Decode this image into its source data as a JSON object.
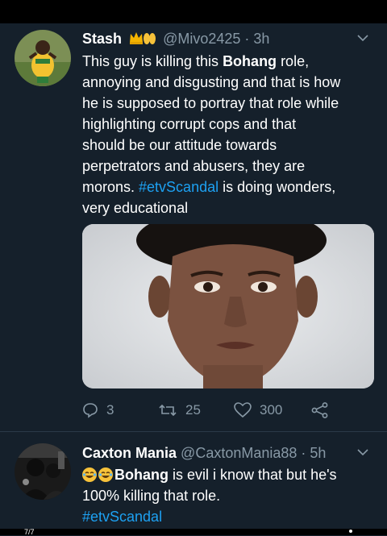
{
  "tweet1": {
    "name": "Stash",
    "handle": "@Mivo2425",
    "time": "· 3h",
    "text": {
      "l1_a": "This guy is killing this ",
      "l1_b": "Bohang",
      "l1_c": " role,",
      "l2": "annoying and disgusting and that is how",
      "l3": "he is supposed to portray that role  while",
      "l4": "highlighting corrupt cops and that",
      "l5": "should be our attitude towards",
      "l6": "perpetrators and abusers, they are",
      "l7_a": "morons. ",
      "l7_tag": "#etvScandal",
      "l7_b": " is doing wonders,",
      "l8": "very educational"
    },
    "replies": "3",
    "retweets": "25",
    "likes": "300"
  },
  "tweet2": {
    "name": "Caxton Mania",
    "handle": "@CaxtonMania88",
    "time": "· 5h",
    "text": {
      "l1_bold": "Bohang",
      "l1_rest": " is evil i know that but he's",
      "l2": "100% killing that role.",
      "l3_tag": "#etvScandal"
    }
  },
  "page_indicator": "7/7",
  "colors": {
    "background": "#15202b",
    "link": "#1da1f2",
    "secondary_text": "#8899a6"
  }
}
